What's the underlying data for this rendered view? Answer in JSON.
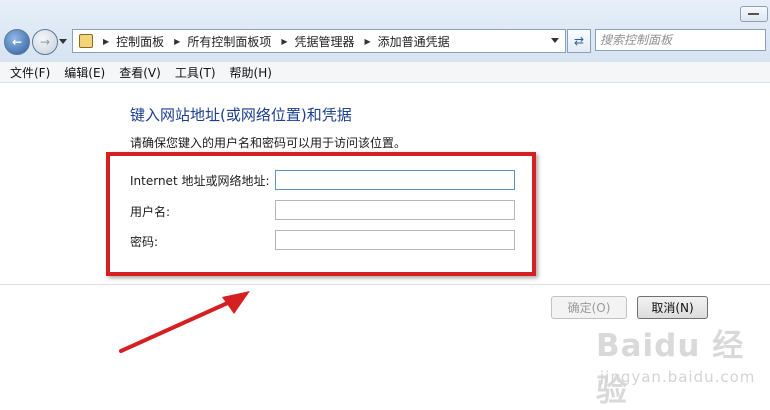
{
  "toolbar": {
    "breadcrumbs": [
      "控制面板",
      "所有控制面板项",
      "凭据管理器",
      "添加普通凭据"
    ],
    "search_placeholder": "搜索控制面板"
  },
  "menu": [
    "文件(F)",
    "编辑(E)",
    "查看(V)",
    "工具(T)",
    "帮助(H)"
  ],
  "form": {
    "heading": "键入网站地址(或网络位置)和凭据",
    "description": "请确保您键入的用户名和密码可以用于访问该位置。",
    "fields": [
      {
        "label": "Internet 地址或网络地址:",
        "value": ""
      },
      {
        "label": "用户名:",
        "value": ""
      },
      {
        "label": "密码:",
        "value": ""
      }
    ]
  },
  "buttons": {
    "ok": "确定(O)",
    "cancel": "取消(N)"
  },
  "watermark": {
    "logo": "Baidu 经验",
    "url": "jingyan.baidu.com"
  },
  "colors": {
    "annotation": "#d42020",
    "heading": "#1b3e8e"
  },
  "icons": [
    "back-arrow-icon",
    "forward-arrow-icon",
    "folder-icon",
    "refresh-icon",
    "search-icon",
    "minimize-icon"
  ]
}
